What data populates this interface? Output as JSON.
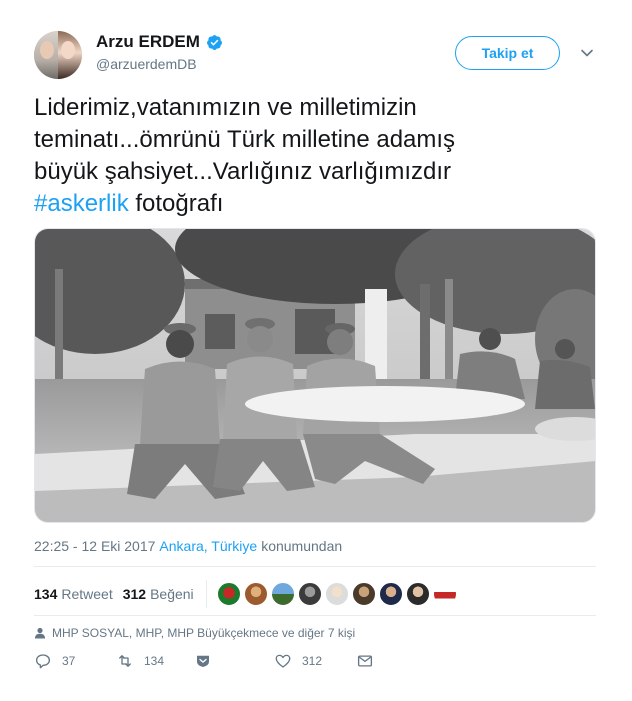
{
  "author": {
    "display_name": "Arzu ERDEM",
    "handle": "@arzuerdemDB",
    "verified_icon": "verified-badge-icon",
    "avatar": "avatar"
  },
  "follow_button": {
    "label": "Takip et"
  },
  "more_menu": {
    "icon": "chevron-down-icon"
  },
  "tweet": {
    "text_line1": "Liderimiz,vatanımızın ve milletimizin",
    "text_line2": "teminatı...ömrünü Türk milletine adamış",
    "text_line3": "büyük şahsiyet...Varlığınız varlığımızdır",
    "hashtag": "#askerlik",
    "text_after_hashtag": " fotoğrafı"
  },
  "photo": {
    "kind": "black-and-white photo"
  },
  "meta": {
    "timestamp": "22:25 - 12 Eki 2017",
    "location": "Ankara, Türkiye",
    "location_suffix": "konumundan"
  },
  "stats": {
    "retweet_count": "134",
    "retweet_label": "Retweet",
    "like_count": "312",
    "like_label": "Beğeni"
  },
  "context": {
    "icon": "person-icon",
    "text": "MHP SOSYAL, MHP, MHP Büyükçekmece ve diğer 7 kişi"
  },
  "actions": {
    "reply_count": "37",
    "retweet_count": "134",
    "like_count": "312",
    "reply_icon": "reply-icon",
    "retweet_icon": "retweet-icon",
    "dm_icon": "direct-message-icon",
    "like_icon": "heart-icon",
    "mail_icon": "envelope-icon"
  },
  "colors": {
    "accent": "#1da1f2",
    "text": "#14171a",
    "muted": "#657786",
    "divider": "#e6ecf0"
  }
}
